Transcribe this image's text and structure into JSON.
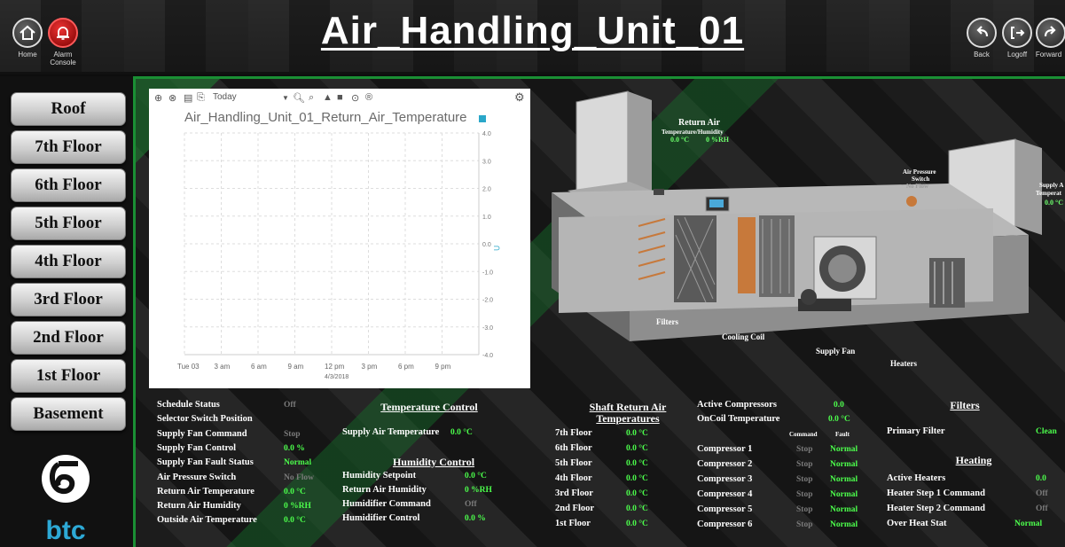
{
  "header": {
    "title": "Air_Handling_Unit_01",
    "home_label": "Home",
    "alarm_label_1": "Alarm",
    "alarm_label_2": "Console",
    "back_label": "Back",
    "logoff_label": "Logoff",
    "forward_label": "Forward"
  },
  "nav": {
    "floors": [
      "Roof",
      "7th Floor",
      "6th Floor",
      "5th Floor",
      "4th Floor",
      "3rd Floor",
      "2nd Floor",
      "1st Floor",
      "Basement"
    ],
    "logo_text": "btc"
  },
  "chart_toolbar": {
    "range": "Today"
  },
  "chart_data": {
    "type": "line",
    "title": "Air_Handling_Unit_01_Return_Air_Temperature",
    "x_ticks": [
      "Tue 03",
      "3 am",
      "6 am",
      "9 am",
      "12 pm",
      "3 pm",
      "6 pm",
      "9 pm"
    ],
    "x_sublabel": "4/3/2018",
    "y_ticks": [
      "4.0",
      "3.0",
      "2.0",
      "1.0",
      "0.0",
      "-1.0",
      "-2.0",
      "-3.0",
      "-4.0"
    ],
    "ylim": [
      -4,
      4
    ],
    "series": [
      {
        "values": []
      }
    ],
    "grid": true,
    "series_color": "#2aa7c9"
  },
  "diagram": {
    "return_air_title": "Return Air",
    "return_air_sub": "Temperature/Humidity",
    "return_air_temp": "0.0 °C",
    "return_air_rh": "0 %RH",
    "air_pressure_switch_1": "Air Pressure",
    "air_pressure_switch_2": "Switch",
    "air_pressure_status": "No Flow",
    "supply_air_1": "Supply A",
    "supply_air_2": "Temperat",
    "supply_air_value": "0.0 °C",
    "filters": "Filters",
    "cooling_coil": "Cooling Coil",
    "supply_fan": "Supply Fan",
    "heaters": "Heaters"
  },
  "status": {
    "col1": [
      {
        "label": "Schedule Status",
        "value": "Off",
        "color": "gray"
      },
      {
        "label": "Selector Switch Position",
        "value": "",
        "color": "gray"
      },
      {
        "label": "Supply Fan Command",
        "value": "Stop",
        "color": "gray"
      },
      {
        "label": "Supply Fan Control",
        "value": "0.0 %",
        "color": "green"
      },
      {
        "label": "Supply Fan Fault Status",
        "value": "Normal",
        "color": "green"
      },
      {
        "label": "Air Pressure Switch",
        "value": "No Flow",
        "color": "gray"
      },
      {
        "label": "Return Air Temperature",
        "value": "0.0 °C",
        "color": "green"
      },
      {
        "label": "Return Air Humidity",
        "value": "0 %RH",
        "color": "green"
      },
      {
        "label": "Outside Air Temperature",
        "value": "0.0 °C",
        "color": "green"
      }
    ],
    "temperature_control": {
      "title": "Temperature Control",
      "supply_air_label": "Supply Air Temperature",
      "supply_air_value": "0.0 °C"
    },
    "humidity_control": {
      "title": "Humidity Control",
      "rows": [
        {
          "label": "Humidity Setpoint",
          "value": "0.0 °C",
          "color": "green"
        },
        {
          "label": "Return Air Humidity",
          "value": "0 %RH",
          "color": "green"
        },
        {
          "label": "Humidifier Command",
          "value": "Off",
          "color": "gray"
        },
        {
          "label": "Humidifier Control",
          "value": "0.0 %",
          "color": "green"
        }
      ]
    },
    "shaft": {
      "title_1": "Shaft Return Air",
      "title_2": "Temperatures",
      "rows": [
        {
          "label": "7th Floor",
          "value": "0.0 °C"
        },
        {
          "label": "6th Floor",
          "value": "0.0 °C"
        },
        {
          "label": "5th Floor",
          "value": "0.0 °C"
        },
        {
          "label": "4th Floor",
          "value": "0.0 °C"
        },
        {
          "label": "3rd Floor",
          "value": "0.0 °C"
        },
        {
          "label": "2nd Floor",
          "value": "0.0 °C"
        },
        {
          "label": "1st Floor",
          "value": "0.0 °C"
        }
      ]
    },
    "compressors": {
      "active_label": "Active Compressors",
      "active_value": "0.0",
      "oncoil_label": "OnCoil Temperature",
      "oncoil_value": "0.0 °C",
      "command_header": "Command",
      "fault_header": "Fault",
      "rows": [
        {
          "label": "Compressor 1",
          "command": "Stop",
          "fault": "Normal"
        },
        {
          "label": "Compressor 2",
          "command": "Stop",
          "fault": "Normal"
        },
        {
          "label": "Compressor 3",
          "command": "Stop",
          "fault": "Normal"
        },
        {
          "label": "Compressor 4",
          "command": "Stop",
          "fault": "Normal"
        },
        {
          "label": "Compressor 5",
          "command": "Stop",
          "fault": "Normal"
        },
        {
          "label": "Compressor 6",
          "command": "Stop",
          "fault": "Normal"
        }
      ]
    },
    "filters": {
      "title": "Filters",
      "primary_label": "Primary Filter",
      "primary_value": "Clean"
    },
    "heating": {
      "title": "Heating",
      "rows": [
        {
          "label": "Active Heaters",
          "value": "0.0",
          "color": "green"
        },
        {
          "label": "Heater Step 1 Command",
          "value": "Off",
          "color": "gray"
        },
        {
          "label": "Heater Step 2 Command",
          "value": "Off",
          "color": "gray"
        },
        {
          "label": "Over Heat Stat",
          "value": "Normal",
          "color": "green"
        }
      ]
    }
  }
}
